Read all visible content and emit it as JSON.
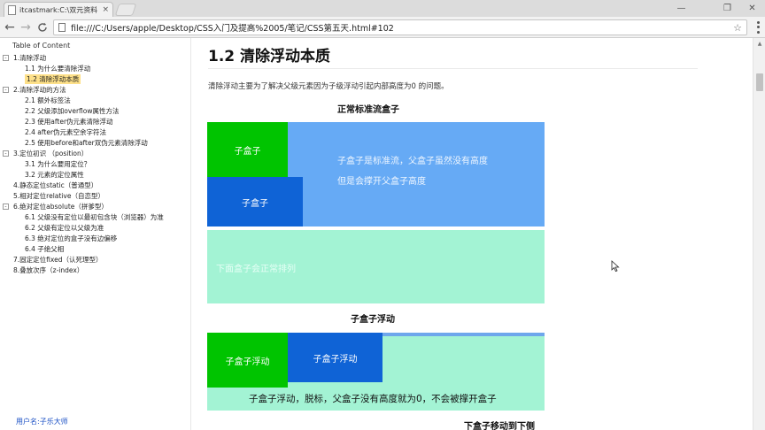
{
  "browser": {
    "tab_title": "itcastmark:C:\\双元资料",
    "tab_close": "×",
    "url": "file:///C:/Users/apple/Desktop/CSS入门及提高%2005/笔记/CSS第五天.html#102",
    "window_controls": {
      "minimize": "—",
      "maximize": "❐",
      "close": "✕"
    },
    "nav": {
      "back": "←",
      "forward": "→",
      "reload": "C"
    },
    "star": "☆"
  },
  "toc": {
    "heading": "Table of Content",
    "items": [
      {
        "label": "1.清除浮动",
        "level": 1,
        "toggle": "-"
      },
      {
        "label": "1.1 为什么要清除浮动",
        "level": 2
      },
      {
        "label": "1.2 清除浮动本质",
        "level": 2,
        "active": true
      },
      {
        "label": "2.清除浮动的方法",
        "level": 1,
        "toggle": "-"
      },
      {
        "label": "2.1 额外标签法",
        "level": 2
      },
      {
        "label": "2.2 父级添加overflow属性方法",
        "level": 2
      },
      {
        "label": "2.3 使用after伪元素清除浮动",
        "level": 2
      },
      {
        "label": "2.4 after伪元素空余字符法",
        "level": 2
      },
      {
        "label": "2.5 使用before和after双伪元素清除浮动",
        "level": 2
      },
      {
        "label": "3.定位初识 （position）",
        "level": 1,
        "toggle": "-"
      },
      {
        "label": "3.1 为什么要用定位？",
        "level": 2
      },
      {
        "label": "3.2 元素的定位属性",
        "level": 2
      },
      {
        "label": "4.静态定位static（普通型）",
        "level": 1
      },
      {
        "label": "5.相对定位relative（自恋型）",
        "level": 1
      },
      {
        "label": "6.绝对定位absolute（拼爹型）",
        "level": 1,
        "toggle": "-"
      },
      {
        "label": "6.1 父级没有定位以最初包含块（浏览器）为准",
        "level": 2
      },
      {
        "label": "6.2 父级有定位以父级为准",
        "level": 2
      },
      {
        "label": "6.3 绝对定位的盒子没有边偏移",
        "level": 2
      },
      {
        "label": "6.4 子绝父相",
        "level": 2
      },
      {
        "label": "7.固定定位fixed（认死理型）",
        "level": 1
      },
      {
        "label": "8.叠放次序（z-index）",
        "level": 1
      }
    ],
    "user_label": "用户名:子乐大师"
  },
  "content": {
    "title": "1.2 清除浮动本质",
    "intro": "清除浮动主要为了解决父级元素因为子级浮动引起内部高度为0 的问题。",
    "demo1": {
      "caption": "正常标准流盒子",
      "child1": "子盒子",
      "child2": "子盒子",
      "parent_text_line1": "子盒子是标准流，父盒子虽然没有高度",
      "parent_text_line2": "但是会撑开父盒子高度",
      "below_text": "下面盒子会正常排列"
    },
    "demo2": {
      "caption": "子盒子浮动",
      "child1": "子盒子浮动",
      "child2": "子盒子浮动",
      "below_text": "子盒子浮动，脱标，父盒子没有高度就为0，不会被撑开盒子"
    },
    "next_caption": "下盒子移动到下侧"
  },
  "colors": {
    "parent_blue": "#66aaf5",
    "child_green": "#00c400",
    "child_blue": "#0f63d6",
    "mint": "#a3f3d4",
    "toc_highlight": "#fde089"
  }
}
